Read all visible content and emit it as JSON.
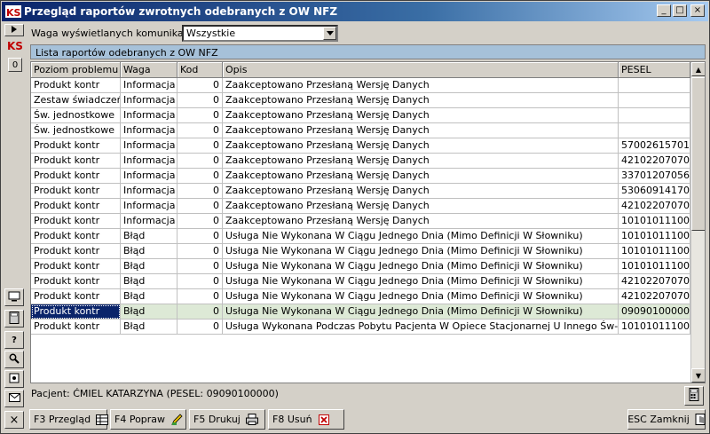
{
  "window": {
    "title": "Przegląd raportów zwrotnych odebranych z OW NFZ",
    "logo_text": "KS",
    "minimize_label": "_",
    "maximize_label": "□",
    "close_label": "×"
  },
  "left_strip": {
    "zero_label": "0",
    "help_label": "?",
    "close_label": "×"
  },
  "filter": {
    "label": "Waga wyświetlanych komunikatów:",
    "value": "Wszystkie"
  },
  "list_title": "Lista raportów odebranych z OW NFZ",
  "table": {
    "columns": [
      "Poziom problemu",
      "Waga",
      "Kod",
      "Opis",
      "PESEL"
    ],
    "rows": [
      [
        "Produkt kontr",
        "Informacja",
        "0",
        "Zaakceptowano Przesłaną Wersję Danych",
        ""
      ],
      [
        "Zestaw świadczeń",
        "Informacja",
        "0",
        "Zaakceptowano Przesłaną Wersję Danych",
        ""
      ],
      [
        "Św. jednostkowe",
        "Informacja",
        "0",
        "Zaakceptowano Przesłaną Wersję Danych",
        ""
      ],
      [
        "Św. jednostkowe",
        "Informacja",
        "0",
        "Zaakceptowano Przesłaną Wersję Danych",
        ""
      ],
      [
        "Produkt kontr",
        "Informacja",
        "0",
        "Zaakceptowano Przesłaną Wersję Danych",
        "57002615701"
      ],
      [
        "Produkt kontr",
        "Informacja",
        "0",
        "Zaakceptowano Przesłaną Wersję Danych",
        "42102207070"
      ],
      [
        "Produkt kontr",
        "Informacja",
        "0",
        "Zaakceptowano Przesłaną Wersję Danych",
        "33701207056"
      ],
      [
        "Produkt kontr",
        "Informacja",
        "0",
        "Zaakceptowano Przesłaną Wersję Danych",
        "53060914170"
      ],
      [
        "Produkt kontr",
        "Informacja",
        "0",
        "Zaakceptowano Przesłaną Wersję Danych",
        "42102207070"
      ],
      [
        "Produkt kontr",
        "Informacja",
        "0",
        "Zaakceptowano Przesłaną Wersję Danych",
        "10101011100"
      ],
      [
        "Produkt kontr",
        "Błąd",
        "0",
        "Usługa Nie Wykonana W Ciągu Jednego Dnia (Mimo Definicji W Słowniku)",
        "10101011100"
      ],
      [
        "Produkt kontr",
        "Błąd",
        "0",
        "Usługa Nie Wykonana W Ciągu Jednego Dnia (Mimo Definicji W Słowniku)",
        "10101011100"
      ],
      [
        "Produkt kontr",
        "Błąd",
        "0",
        "Usługa Nie Wykonana W Ciągu Jednego Dnia (Mimo Definicji W Słowniku)",
        "10101011100"
      ],
      [
        "Produkt kontr",
        "Błąd",
        "0",
        "Usługa Nie Wykonana W Ciągu Jednego Dnia (Mimo Definicji W Słowniku)",
        "42102207070"
      ],
      [
        "Produkt kontr",
        "Błąd",
        "0",
        "Usługa Nie Wykonana W Ciągu Jednego Dnia (Mimo Definicji W Słowniku)",
        "42102207070"
      ],
      [
        "Produkt kontr",
        "Błąd",
        "0",
        "Usługa Nie Wykonana W Ciągu Jednego Dnia (Mimo Definicji W Słowniku)",
        "09090100000"
      ],
      [
        "Produkt kontr",
        "Błąd",
        "0",
        "Usługa Wykonana Podczas Pobytu Pacjenta W Opiece Stacjonarnej U Innego Św-Dawcy",
        "10101011100"
      ]
    ],
    "selected_row": 15,
    "scrollbar_up": "▲",
    "scrollbar_down": "▼"
  },
  "patient_info": "Pacjent: ĆMIEL KATARZYNA (PESEL: 09090100000)",
  "buttons": {
    "f3": "F3 Przegląd",
    "f4": "F4 Popraw",
    "f5": "F5 Drukuj",
    "f8": "F8 Usuń",
    "esc": "ESC Zamknij"
  },
  "colors": {
    "title_bar": "#0a246a",
    "list_title_bg": "#a6c1d9",
    "selected_row_bg": "#dde9d6",
    "selected_cell_bg": "#0a246a"
  }
}
